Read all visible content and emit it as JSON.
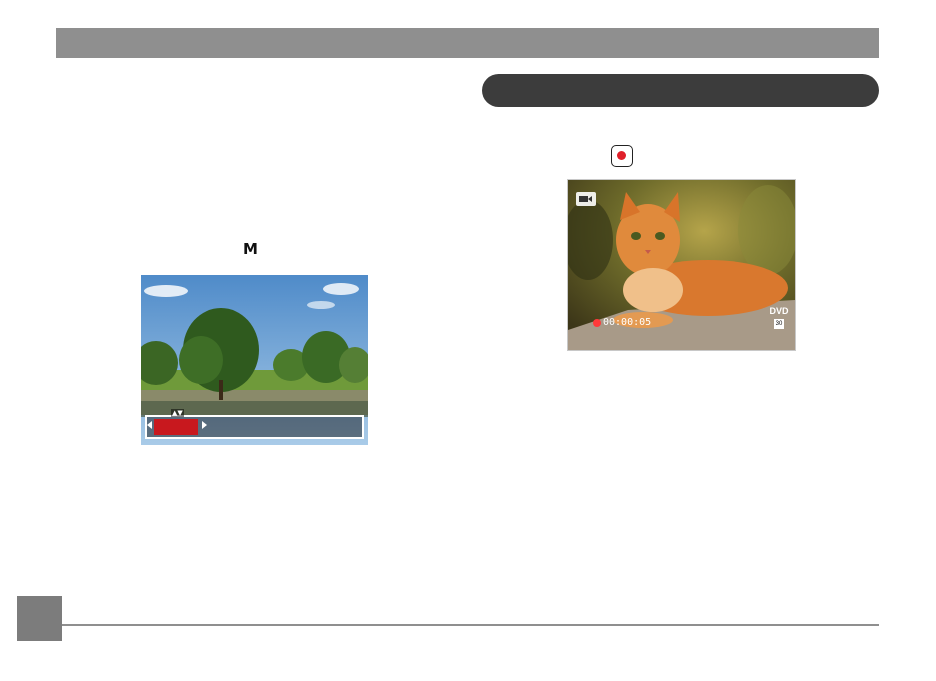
{
  "left_column": {
    "mode_glyph": "M"
  },
  "wb_menu": {
    "options": [
      "",
      "",
      "",
      ""
    ],
    "selected_index": 0
  },
  "video_preview": {
    "record_time": "00:00:05",
    "quality_label": "DVD",
    "fps_label": "30"
  },
  "colors": {
    "header_bar": "#8f8f8f",
    "section_pill": "#3c3c3c",
    "record_red": "#e0202a",
    "wb_selected": "#c8181e",
    "page_tab": "#7c7c7c"
  },
  "icons": {
    "record_button": "record-button-icon",
    "video_mode": "video-camera-icon"
  }
}
